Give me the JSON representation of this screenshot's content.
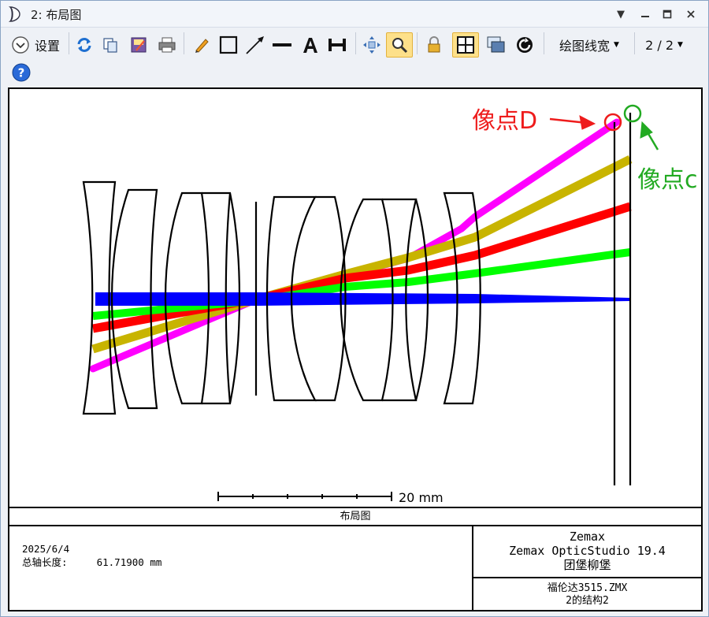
{
  "window": {
    "title": "2: 布局图"
  },
  "toolbar": {
    "settings_label": "设置",
    "linewidth_label": "绘图线宽",
    "page_label": "2 / 2"
  },
  "plot": {
    "annotation_d": "像点D",
    "annotation_c": "像点c",
    "scale_label": "20 mm"
  },
  "caption": "布局图",
  "info": {
    "date": "2025/6/4",
    "total_length_label": "总轴长度:",
    "total_length_value": "61.71900 mm",
    "company": "Zemax",
    "product": "Zemax OpticStudio 19.4",
    "author": "团堡柳堡",
    "file": "福伦达3515.ZMX",
    "config": "2的结构2"
  },
  "colors": {
    "ray_blue": "#0000ff",
    "ray_green": "#00ff00",
    "ray_red": "#ff0000",
    "ray_olive": "#c8b400",
    "ray_magenta": "#ff00ff",
    "annotation_red": "#ee1c1c",
    "annotation_green": "#22aa22",
    "active_button": "#fde08a"
  }
}
